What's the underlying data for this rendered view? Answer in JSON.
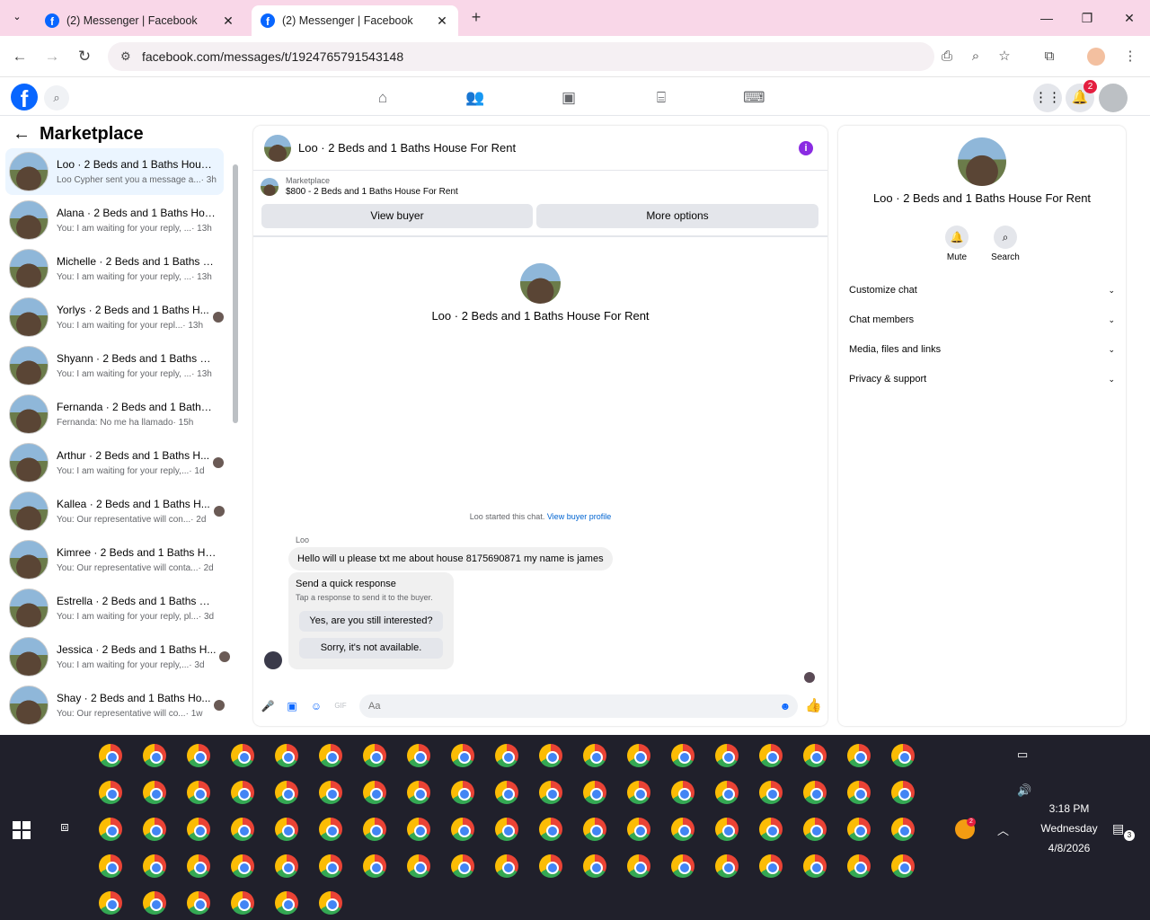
{
  "browser": {
    "tabs": [
      {
        "title": "(2) Messenger | Facebook"
      },
      {
        "title": "(2) Messenger | Facebook"
      }
    ],
    "new_tab": "+",
    "url": "facebook.com/messages/t/1924765791543148"
  },
  "fb_header": {
    "logo": "f",
    "notification_count": "2"
  },
  "sidebar": {
    "title": "Marketplace",
    "conversations": [
      {
        "name": "Loo · 2 Beds and 1 Baths House ...",
        "preview": "Loo Cypher sent you a message a...",
        "time": "· 3h"
      },
      {
        "name": "Alana · 2 Beds and 1 Baths Hou...",
        "preview": "You: I am waiting for your reply, ...",
        "time": "· 13h"
      },
      {
        "name": "Michelle · 2 Beds and 1 Baths H...",
        "preview": "You: I am waiting for your reply, ...",
        "time": "· 13h"
      },
      {
        "name": "Yorlys · 2 Beds and 1 Baths H...",
        "preview": "You: I am waiting for your repl...",
        "time": "· 13h"
      },
      {
        "name": "Shyann · 2 Beds and 1 Baths Ho...",
        "preview": "You: I am waiting for your reply, ...",
        "time": "· 13h"
      },
      {
        "name": "Fernanda · 2 Beds and 1 Baths ...",
        "preview": "Fernanda: No me ha llamado",
        "time": "· 15h"
      },
      {
        "name": "Arthur · 2 Beds and 1 Baths H...",
        "preview": "You: I am waiting for your reply,...",
        "time": "· 1d"
      },
      {
        "name": "Kallea · 2 Beds and 1 Baths H...",
        "preview": "You: Our representative will con...",
        "time": "· 2d"
      },
      {
        "name": "Kimree · 2 Beds and 1 Baths Ho...",
        "preview": "You: Our representative will conta...",
        "time": "· 2d"
      },
      {
        "name": "Estrella · 2 Beds and 1 Baths Ho...",
        "preview": "You: I am waiting for your reply, pl...",
        "time": "· 3d"
      },
      {
        "name": "Jessica · 2 Beds and 1 Baths H...",
        "preview": "You: I am waiting for your reply,...",
        "time": "· 3d"
      },
      {
        "name": "Shay · 2 Beds and 1 Baths Ho...",
        "preview": "You: Our representative will co...",
        "time": "· 1w"
      }
    ]
  },
  "chat": {
    "title": "Loo · 2 Beds and 1 Baths House For Rent",
    "marketplace_label": "Marketplace",
    "listing": "$800 - 2 Beds and 1 Baths House For Rent",
    "view_buyer": "View buyer",
    "more_options": "More options",
    "center_title": "Loo · 2 Beds and 1 Baths House For Rent",
    "started_text": "Loo started this chat.",
    "view_buyer_profile": "View buyer profile",
    "sender": "Loo",
    "message": "Hello will u please txt me about house 8175690871 my name is james",
    "quick_title": "Send a quick response",
    "quick_subtitle": "Tap a response to send it to the buyer.",
    "quick_1": "Yes, are you still interested?",
    "quick_2": "Sorry, it's not available.",
    "input_placeholder": "Aa"
  },
  "info_panel": {
    "name": "Loo · 2 Beds and 1 Baths House For Rent",
    "mute": "Mute",
    "search": "Search",
    "sections": [
      "Customize chat",
      "Chat members",
      "Media, files and links",
      "Privacy & support"
    ]
  },
  "taskbar": {
    "time": "3:18 PM",
    "day": "Wednesday",
    "date": "4/8/2026",
    "tray_badge": "2",
    "notif_count": "3"
  }
}
